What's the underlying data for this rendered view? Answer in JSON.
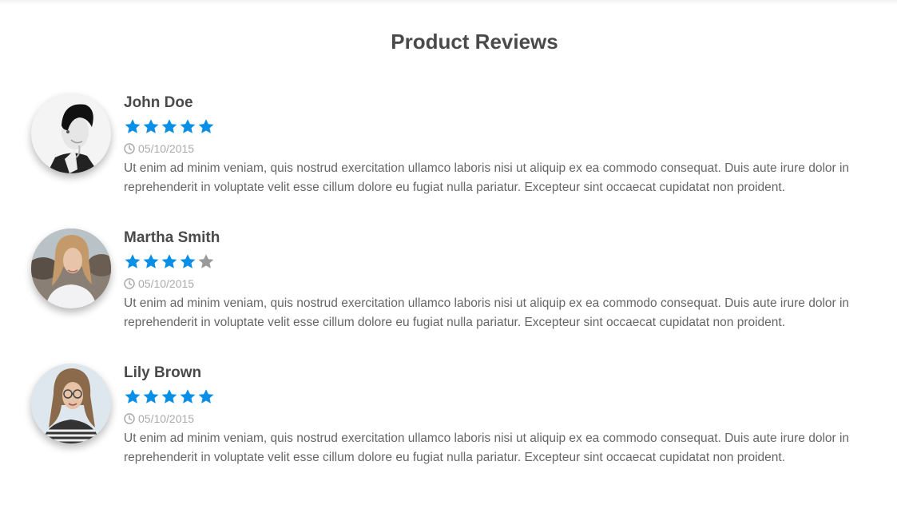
{
  "page": {
    "title": "Product Reviews"
  },
  "colors": {
    "star_filled": "#0a8fe6",
    "star_empty": "#9a9a9a",
    "title": "#4a4a4a",
    "date": "#aaaaaa"
  },
  "reviews": [
    {
      "name": "John Doe",
      "rating": 5,
      "max_rating": 5,
      "date": "05/10/2015",
      "text": "Ut enim ad minim veniam, quis nostrud exercitation ullamco laboris nisi ut aliquip ex ea commodo consequat. Duis aute irure dolor in reprehenderit in voluptate velit esse cillum dolore eu fugiat nulla pariatur. Excepteur sint occaecat cupidatat non proident.",
      "avatar_icon": "man-portrait-bw"
    },
    {
      "name": "Martha Smith",
      "rating": 4,
      "max_rating": 5,
      "date": "05/10/2015",
      "text": "Ut enim ad minim veniam, quis nostrud exercitation ullamco laboris nisi ut aliquip ex ea commodo consequat. Duis aute irure dolor in reprehenderit in voluptate velit esse cillum dolore eu fugiat nulla pariatur. Excepteur sint occaecat cupidatat non proident.",
      "avatar_icon": "woman-portrait-blonde"
    },
    {
      "name": "Lily Brown",
      "rating": 5,
      "max_rating": 5,
      "date": "05/10/2015",
      "text": "Ut enim ad minim veniam, quis nostrud exercitation ullamco laboris nisi ut aliquip ex ea commodo consequat. Duis aute irure dolor in reprehenderit in voluptate velit esse cillum dolore eu fugiat nulla pariatur. Excepteur sint occaecat cupidatat non proident.",
      "avatar_icon": "woman-portrait-glasses"
    }
  ]
}
